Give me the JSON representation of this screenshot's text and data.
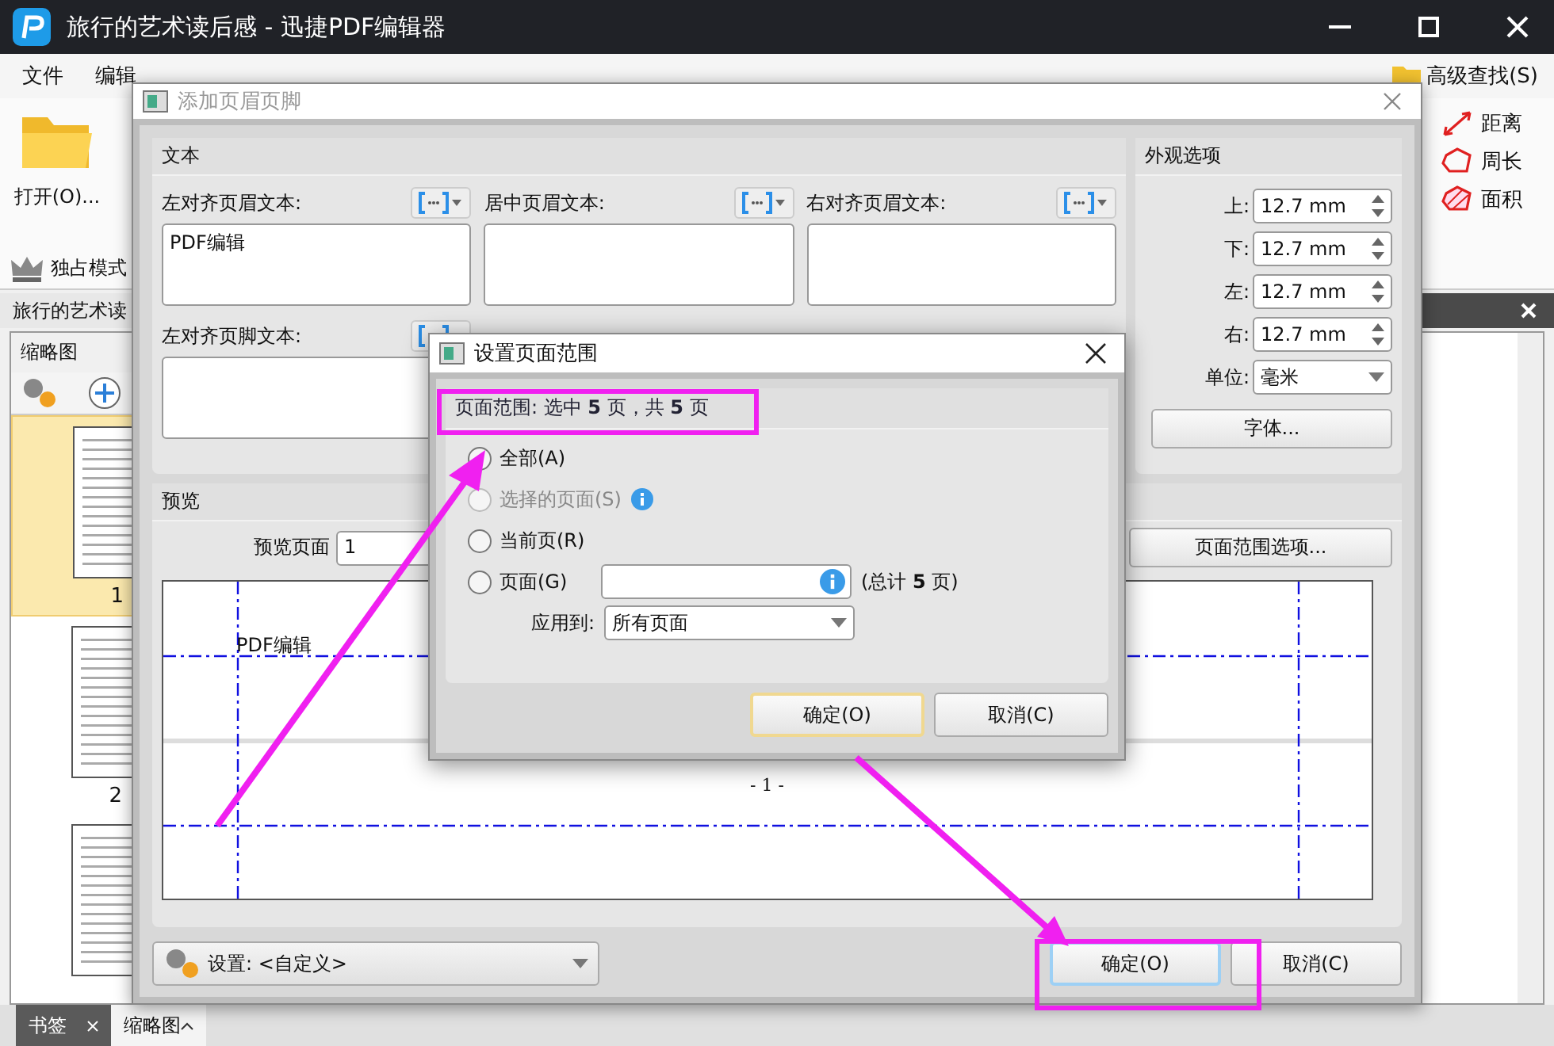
{
  "window": {
    "title": "旅行的艺术读后感 - 迅捷PDF编辑器"
  },
  "menu": [
    {
      "label": "文件",
      "selected": false
    },
    {
      "label": "编辑",
      "selected": false
    }
  ],
  "ribbon": {
    "open_button": "打开(O)...",
    "exclusive_mode": "独占模式",
    "advanced_find": "高级查找(S)",
    "measure": [
      "距离",
      "周长",
      "面积"
    ]
  },
  "doc_tab": {
    "title": "旅行的艺术读"
  },
  "thumbnails_panel": {
    "title": "缩略图",
    "pages": [
      {
        "label": "1",
        "selected": true
      },
      {
        "label": "2",
        "selected": false
      },
      {
        "selected": false
      }
    ]
  },
  "bottom_tabs": [
    {
      "label": "书签",
      "selected": false
    },
    {
      "label": "缩略图",
      "selected": true
    }
  ],
  "header_footer_dialog": {
    "title": "添加页眉页脚",
    "text_group": "文本",
    "fields": [
      {
        "label": "左对齐页眉文本:",
        "value": "PDF编辑"
      },
      {
        "label": "居中页眉文本:"
      },
      {
        "label": "右对齐页眉文本:"
      },
      {
        "label": "左对齐页脚文本:"
      }
    ],
    "appearance": {
      "title": "外观选项",
      "margins": [
        {
          "label": "上:",
          "value": "12.7 mm"
        },
        {
          "label": "下:",
          "value": "12.7 mm"
        },
        {
          "label": "左:",
          "value": "12.7 mm"
        },
        {
          "label": "右:",
          "value": "12.7 mm"
        }
      ],
      "unit_label": "单位:",
      "unit": "毫米",
      "font_button": "字体..."
    },
    "preview": {
      "title": "预览",
      "page_label": "预览页面",
      "page": "1",
      "range_button": "页面范围选项...",
      "header_text": "PDF编辑",
      "footer_text": "- 1 -"
    },
    "settings": "设置: <自定义>",
    "buttons": [
      "确定(O)",
      "取消(C)"
    ]
  },
  "range_dialog": {
    "title": "设置页面范围",
    "summary": "页面范围: 选中 **5** 页，共 **5** 页",
    "options": [
      {
        "kind": "plain",
        "label": "全部(A)",
        "selected": false,
        "disabled": false
      },
      {
        "kind": "info",
        "label": "选择的页面(S)",
        "selected": false,
        "disabled": true
      },
      {
        "kind": "plain",
        "label": "当前页(R)",
        "selected": false,
        "disabled": false
      },
      {
        "kind": "field",
        "label": "页面(G)",
        "selected": false,
        "disabled": false,
        "total": "(总计 **5** 页)"
      }
    ],
    "apply_label": "应用到:",
    "apply_value": "所有页面",
    "buttons": [
      {
        "label": "确定(O)",
        "default": true
      },
      {
        "label": "取消(C)",
        "default": false
      }
    ]
  }
}
